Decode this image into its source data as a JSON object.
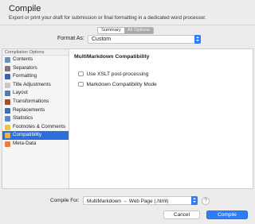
{
  "window": {
    "title": "Compile",
    "subtitle": "Export or print your draft for submission or final formatting in a dedicated word processor."
  },
  "view_tabs": {
    "summary": "Summary",
    "all_options": "All Options",
    "selected": "All Options"
  },
  "format_as": {
    "label": "Format As:",
    "value": "Custom"
  },
  "sidebar": {
    "header": "Compilation Options",
    "items": [
      {
        "label": "Contents",
        "icon": "contents-icon",
        "color": "#6e8fb8"
      },
      {
        "label": "Separators",
        "icon": "separators-icon",
        "color": "#7a7a7a"
      },
      {
        "label": "Formatting",
        "icon": "formatting-icon",
        "color": "#3d62b8"
      },
      {
        "label": "Title Adjustments",
        "icon": "title-adjustments-icon",
        "color": "#c8c8c8"
      },
      {
        "label": "Layout",
        "icon": "layout-icon",
        "color": "#5a78a8"
      },
      {
        "label": "Transformations",
        "icon": "transformations-icon",
        "color": "#a0522d"
      },
      {
        "label": "Replacements",
        "icon": "replacements-icon",
        "color": "#3e6ea8"
      },
      {
        "label": "Statistics",
        "icon": "statistics-icon",
        "color": "#5b8ac0"
      },
      {
        "label": "Footnotes & Comments",
        "icon": "footnotes-comments-icon",
        "color": "#e7c64a"
      },
      {
        "label": "Compatibility",
        "icon": "compatibility-icon",
        "color": "#e3b640"
      },
      {
        "label": "Meta-Data",
        "icon": "meta-data-icon",
        "color": "#f07b3e"
      }
    ],
    "selected_index": 9
  },
  "pane": {
    "title": "MultiMarkdown Compatibility",
    "options": [
      {
        "label": "Use XSLT post-processing",
        "checked": false
      },
      {
        "label": "Markdown Compatibility Mode",
        "checked": false
      }
    ]
  },
  "compile_for": {
    "label": "Compile For:",
    "value": "MultiMarkdown → Web Page (.html)"
  },
  "help_label": "?",
  "buttons": {
    "cancel": "Cancel",
    "compile": "Compile"
  },
  "colors": {
    "accent": "#2f7df6",
    "selection": "#2c6edc"
  }
}
